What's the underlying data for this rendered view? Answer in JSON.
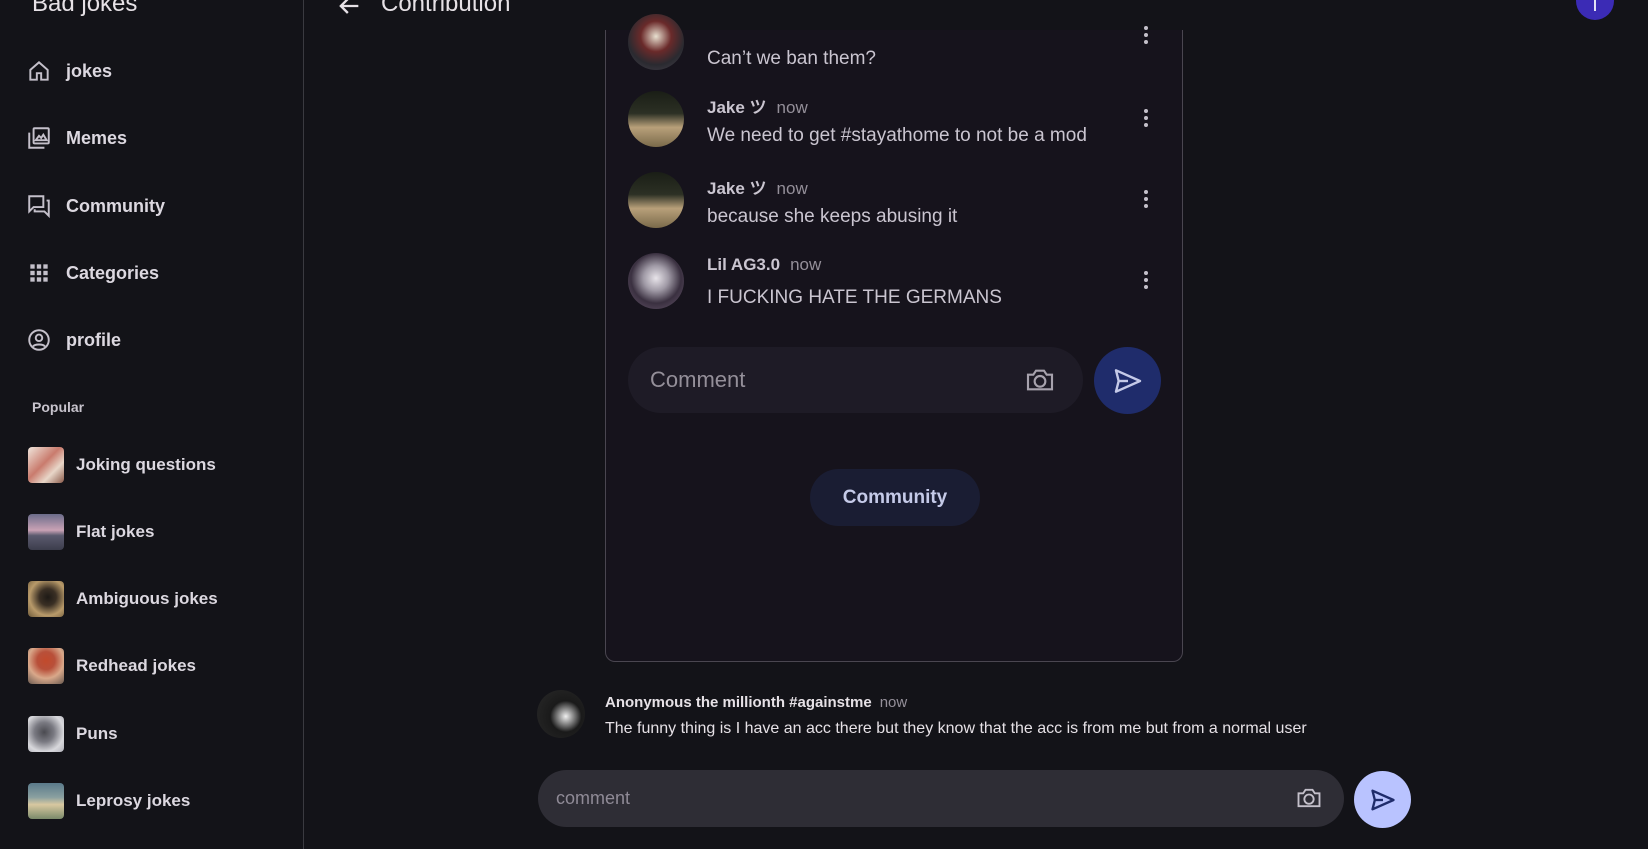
{
  "app": {
    "title": "Bad jokes"
  },
  "nav": [
    {
      "label": "jokes",
      "icon": "home-icon"
    },
    {
      "label": "Memes",
      "icon": "gallery-icon"
    },
    {
      "label": "Community",
      "icon": "forum-icon"
    },
    {
      "label": "Categories",
      "icon": "grid-icon"
    },
    {
      "label": "profile",
      "icon": "account-circle-icon"
    }
  ],
  "popular": {
    "label": "Popular",
    "items": [
      {
        "label": "Joking questions"
      },
      {
        "label": "Flat jokes"
      },
      {
        "label": "Ambiguous jokes"
      },
      {
        "label": "Redhead jokes"
      },
      {
        "label": "Puns"
      },
      {
        "label": "Leprosy jokes"
      }
    ]
  },
  "header": {
    "title": "Contribution",
    "avatar_letter": "T"
  },
  "thread": {
    "comments": [
      {
        "author": "",
        "time": "",
        "text": "Can’t we ban them?"
      },
      {
        "author": "Jake ツ",
        "time": "now",
        "text": "We need to get #stayathome to not be a mod"
      },
      {
        "author": "Jake ツ",
        "time": "now",
        "text": "because she keeps abusing it"
      },
      {
        "author": "Lil AG3.0",
        "time": "now",
        "text": "I FUCKING HATE THE GERMANS"
      }
    ],
    "comment_placeholder": "Comment",
    "community_button": "Community"
  },
  "reply": {
    "author": "Anonymous the millionth #againstme",
    "time": "now",
    "text": "The funny thing is I have an acc there but they know that the acc is from me but from a normal user"
  },
  "bottom_input": {
    "placeholder": "comment"
  },
  "colors": {
    "accent": "#3b2bb5",
    "send_light": "#b9c3ff",
    "send_dark": "#1f2c6b"
  }
}
